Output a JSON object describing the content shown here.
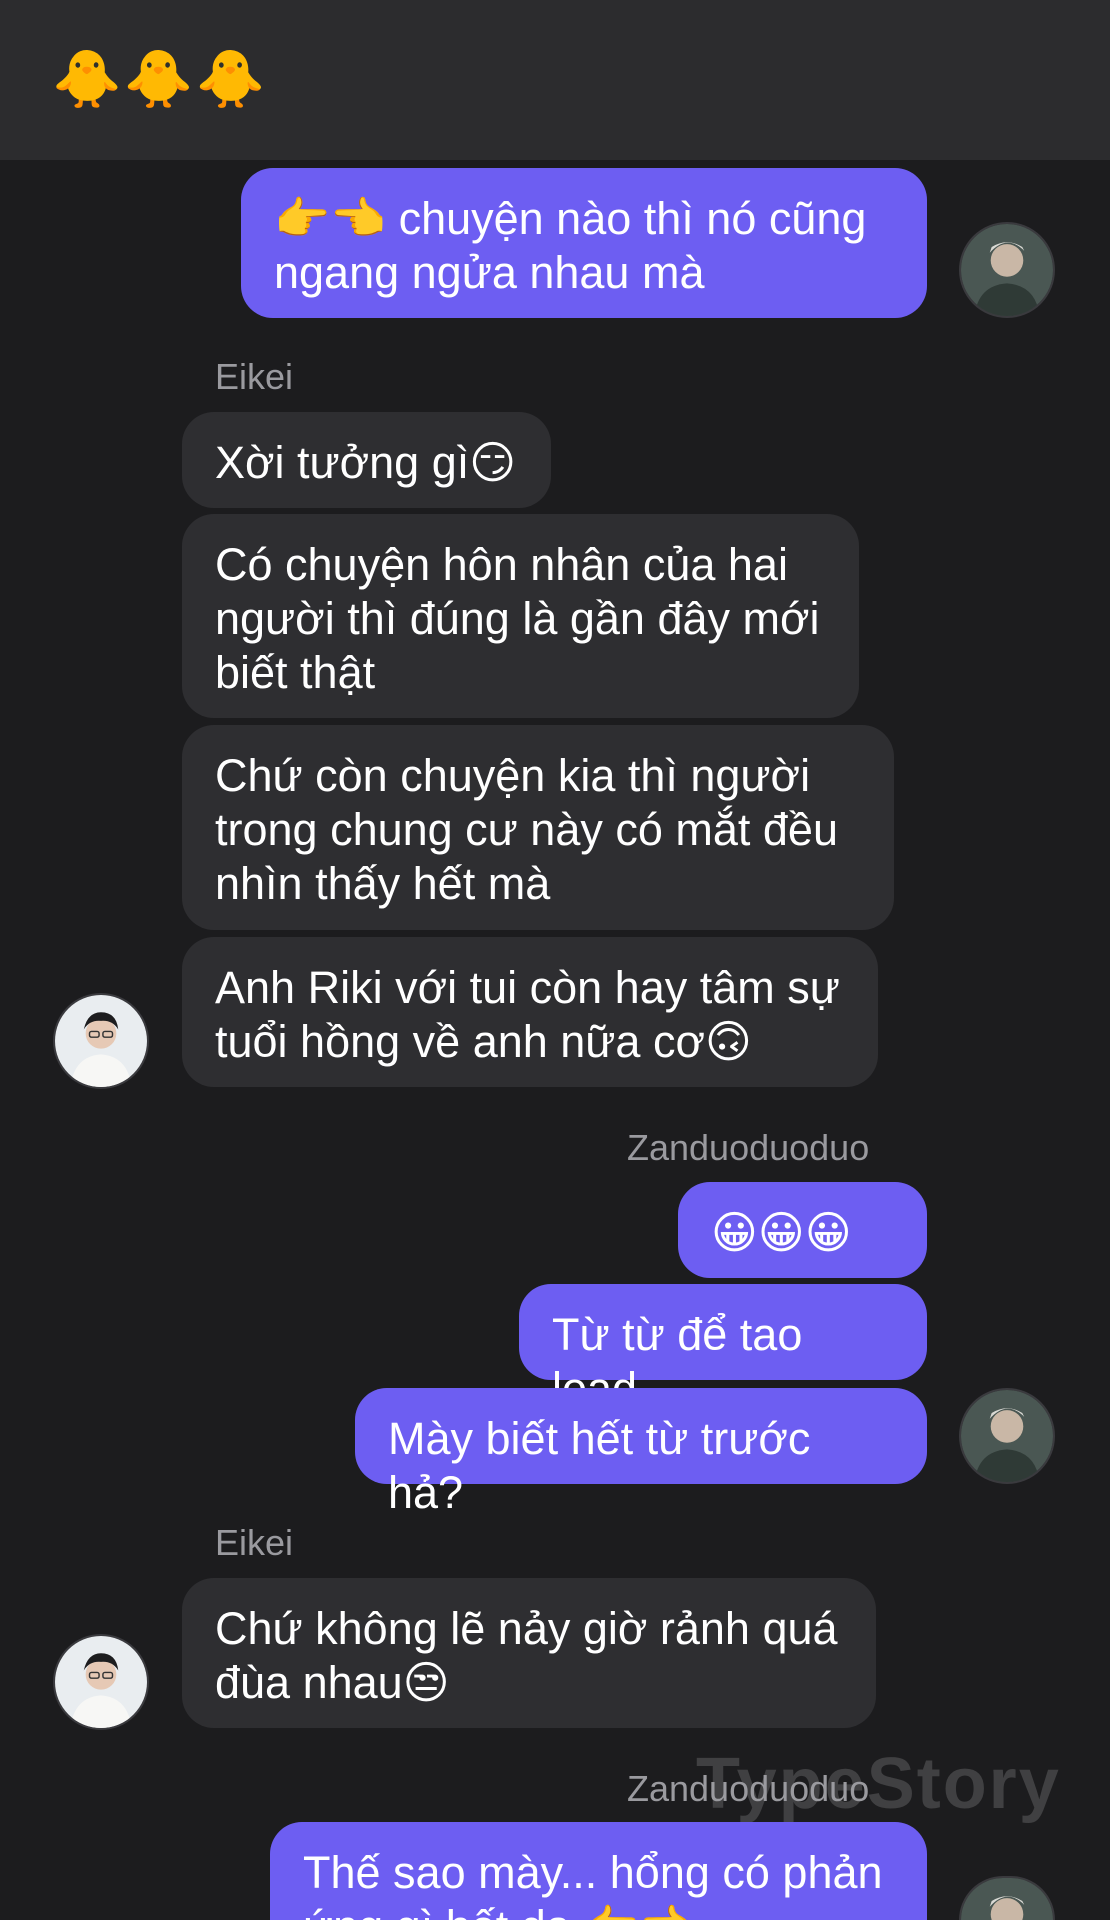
{
  "header": {
    "title": "🐥🐥🐥"
  },
  "watermark": "TypeStory",
  "messages": [
    {
      "text": "👉👈 chuyện nào thì nó cũng\nngang ngửa nhau mà"
    },
    {
      "text": "Xời tưởng gì😏"
    },
    {
      "text": "Có chuyện hôn nhân của hai\nngười thì đúng là gần đây mới\nbiết thật"
    },
    {
      "text": "Chứ còn chuyện kia thì người\ntrong chung cư này có mắt đều\nnhìn thấy hết mà"
    },
    {
      "text": "Anh Riki với tui còn hay tâm sự\ntuổi hồng về anh nữa cơ🙃"
    },
    {
      "text": "😀😀😀"
    },
    {
      "text": "Từ từ để tao load"
    },
    {
      "text": "Mày biết hết từ trước hả?"
    },
    {
      "text": "Chứ không lẽ nảy giờ rảnh quá\nđùa nhau😒"
    },
    {
      "text": "Thế sao mày... hổng có phản\nứng gì hết dạ 👉👈"
    }
  ],
  "senders": {
    "eikei_1": "Eikei",
    "zan_1": "Zanduoduoduo",
    "eikei_2": "Eikei",
    "zan_2": "Zanduoduoduo"
  },
  "colors": {
    "background": "#1c1c1e",
    "header": "#2c2c2e",
    "outgoing_bubble": "#6d5ef2",
    "incoming_bubble": "#2e2e31",
    "sender_name": "#9a9a9f"
  },
  "avatars": {
    "self": "avatar-self",
    "eikei": "avatar-eikei"
  }
}
